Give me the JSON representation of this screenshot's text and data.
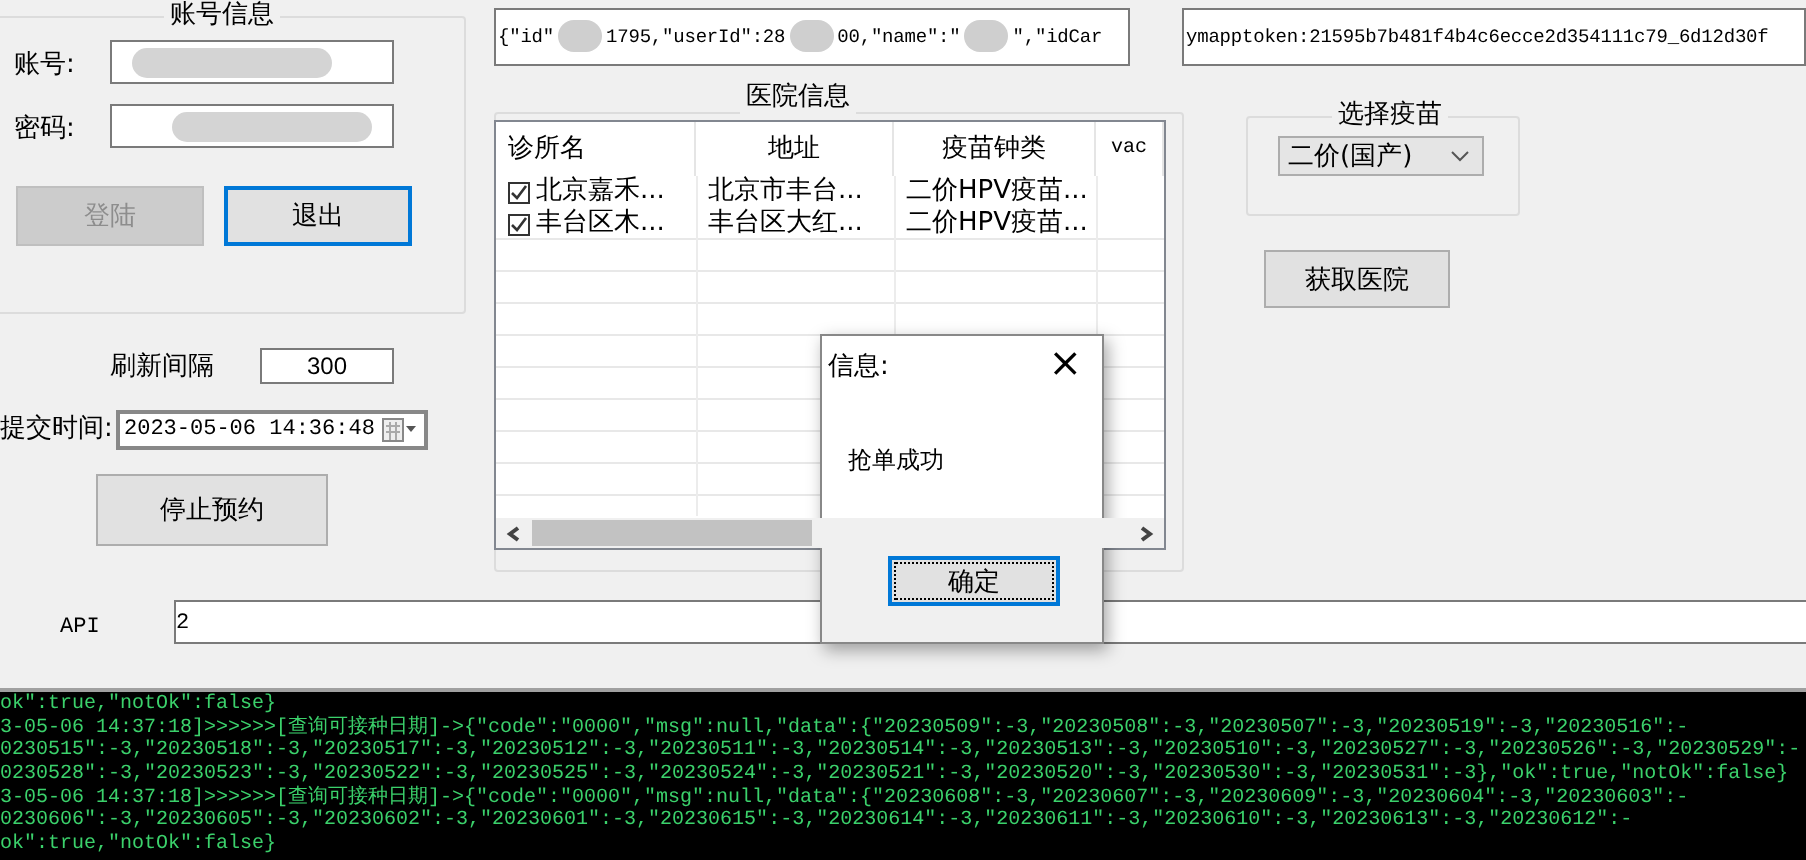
{
  "account_group": {
    "title": "账号信息",
    "account_label": "账号:",
    "password_label": "密码:",
    "buttons": [
      {
        "label": "登陆",
        "disabled": true,
        "focused": false
      },
      {
        "label": "退出",
        "disabled": false,
        "focused": true
      }
    ]
  },
  "refresh": {
    "label": "刷新间隔",
    "value": "300"
  },
  "submit_time": {
    "label": "提交时间:",
    "value": "2023-05-06 14:36:48"
  },
  "stop_button": "停止预约",
  "user_json": [
    "{\"id\"",
    "1795,\"userId\":28",
    "00,\"name\":\"",
    "\",\"idCar"
  ],
  "token": "ymapptoken:21595b7b481f4b4c6ecce2d354111c79_6d12d30f",
  "hospital_group": {
    "title": "医院信息",
    "columns": [
      "诊所名",
      "地址",
      "疫苗钟类",
      "vac"
    ],
    "rows": [
      {
        "checked": true,
        "cells": [
          "北京嘉禾...",
          "北京市丰台...",
          "二价HPV疫苗..."
        ]
      },
      {
        "checked": true,
        "cells": [
          "丰台区木...",
          "丰台区大红...",
          "二价HPV疫苗..."
        ]
      }
    ]
  },
  "vaccine_group": {
    "title": "选择疫苗",
    "value": "二价(国产)"
  },
  "fetch_button": "获取医院",
  "api": {
    "label": "API",
    "value": "2"
  },
  "console": [
    "ok\":true,\"notOk\":false}",
    "3-05-06 14:37:18]>>>>>>[查询可接种日期]->{\"code\":\"0000\",\"msg\":null,\"data\":{\"20230509\":-3,\"20230508\":-3,\"20230507\":-3,\"20230519\":-3,\"20230516\":-",
    "0230515\":-3,\"20230518\":-3,\"20230517\":-3,\"20230512\":-3,\"20230511\":-3,\"20230514\":-3,\"20230513\":-3,\"20230510\":-3,\"20230527\":-3,\"20230526\":-3,\"20230529\":-",
    "0230528\":-3,\"20230523\":-3,\"20230522\":-3,\"20230525\":-3,\"20230524\":-3,\"20230521\":-3,\"20230520\":-3,\"20230530\":-3,\"20230531\":-3},\"ok\":true,\"notOk\":false}",
    "3-05-06 14:37:18]>>>>>>[查询可接种日期]->{\"code\":\"0000\",\"msg\":null,\"data\":{\"20230608\":-3,\"20230607\":-3,\"20230609\":-3,\"20230604\":-3,\"20230603\":-",
    "0230606\":-3,\"20230605\":-3,\"20230602\":-3,\"20230601\":-3,\"20230615\":-3,\"20230614\":-3,\"20230611\":-3,\"20230610\":-3,\"20230613\":-3,\"20230612\":-",
    "ok\":true,\"notOk\":false}"
  ],
  "dialog": {
    "title": "信息:",
    "close": "×",
    "message": "抢单成功",
    "button": "确定"
  }
}
